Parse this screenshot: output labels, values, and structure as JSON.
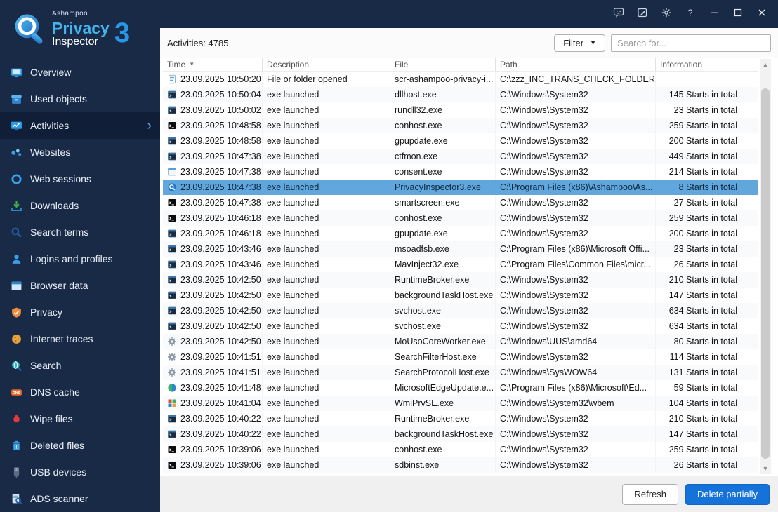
{
  "window": {
    "titlebar_icons": [
      {
        "name": "feedback"
      },
      {
        "name": "notes"
      },
      {
        "name": "settings"
      },
      {
        "name": "help"
      },
      {
        "name": "minimize"
      },
      {
        "name": "maximize"
      },
      {
        "name": "close"
      }
    ]
  },
  "logo": {
    "brand": "Ashampoo",
    "product": "Privacy",
    "product2": "Inspector",
    "version": "3"
  },
  "sidebar": {
    "items": [
      {
        "label": "Overview",
        "icon": "overview",
        "selected": false
      },
      {
        "label": "Used objects",
        "icon": "used-objects",
        "selected": false
      },
      {
        "label": "Activities",
        "icon": "activities",
        "selected": true
      },
      {
        "label": "Websites",
        "icon": "websites",
        "selected": false
      },
      {
        "label": "Web sessions",
        "icon": "web-sessions",
        "selected": false
      },
      {
        "label": "Downloads",
        "icon": "downloads",
        "selected": false
      },
      {
        "label": "Search terms",
        "icon": "search-terms",
        "selected": false
      },
      {
        "label": "Logins and profiles",
        "icon": "logins",
        "selected": false
      },
      {
        "label": "Browser data",
        "icon": "browser-data",
        "selected": false
      },
      {
        "label": "Privacy",
        "icon": "privacy",
        "selected": false
      },
      {
        "label": "Internet traces",
        "icon": "internet-traces",
        "selected": false
      },
      {
        "label": "Search",
        "icon": "search",
        "selected": false
      },
      {
        "label": "DNS cache",
        "icon": "dns-cache",
        "selected": false
      },
      {
        "label": "Wipe files",
        "icon": "wipe-files",
        "selected": false
      },
      {
        "label": "Deleted files",
        "icon": "deleted-files",
        "selected": false
      },
      {
        "label": "USB devices",
        "icon": "usb-devices",
        "selected": false
      },
      {
        "label": "ADS scanner",
        "icon": "ads-scanner",
        "selected": false
      }
    ]
  },
  "toolbar": {
    "activities_count": "Activities: 4785",
    "filter_label": "Filter",
    "search_placeholder": "Search for..."
  },
  "table": {
    "columns": [
      {
        "label": "Time",
        "sort": "desc"
      },
      {
        "label": "Description"
      },
      {
        "label": "File"
      },
      {
        "label": "Path"
      },
      {
        "label": "Information"
      }
    ],
    "rows": [
      {
        "time": "23.09.2025 10:50:20",
        "description": "File or folder opened",
        "file": "scr-ashampoo-privacy-i...",
        "path": "C:\\zzz_INC_TRANS_CHECK_FOLDER",
        "information": "",
        "icon": "doc",
        "selected": false
      },
      {
        "time": "23.09.2025 10:50:04",
        "description": "exe launched",
        "file": "dllhost.exe",
        "path": "C:\\Windows\\System32",
        "information": "145 Starts in total",
        "icon": "win",
        "selected": false
      },
      {
        "time": "23.09.2025 10:50:02",
        "description": "exe launched",
        "file": "rundll32.exe",
        "path": "C:\\Windows\\System32",
        "information": "23 Starts in total",
        "icon": "win",
        "selected": false
      },
      {
        "time": "23.09.2025 10:48:58",
        "description": "exe launched",
        "file": "conhost.exe",
        "path": "C:\\Windows\\System32",
        "information": "259 Starts in total",
        "icon": "console",
        "selected": false
      },
      {
        "time": "23.09.2025 10:48:58",
        "description": "exe launched",
        "file": "gpupdate.exe",
        "path": "C:\\Windows\\System32",
        "information": "200 Starts in total",
        "icon": "win",
        "selected": false
      },
      {
        "time": "23.09.2025 10:47:38",
        "description": "exe launched",
        "file": "ctfmon.exe",
        "path": "C:\\Windows\\System32",
        "information": "449 Starts in total",
        "icon": "win",
        "selected": false
      },
      {
        "time": "23.09.2025 10:47:38",
        "description": "exe launched",
        "file": "consent.exe",
        "path": "C:\\Windows\\System32",
        "information": "214 Starts in total",
        "icon": "winlight",
        "selected": false
      },
      {
        "time": "23.09.2025 10:47:38",
        "description": "exe launched",
        "file": "PrivacyInspector3.exe",
        "path": "C:\\Program Files (x86)\\Ashampoo\\As...",
        "information": "8 Starts in total",
        "icon": "app",
        "selected": true
      },
      {
        "time": "23.09.2025 10:47:38",
        "description": "exe launched",
        "file": "smartscreen.exe",
        "path": "C:\\Windows\\System32",
        "information": "27 Starts in total",
        "icon": "console",
        "selected": false
      },
      {
        "time": "23.09.2025 10:46:18",
        "description": "exe launched",
        "file": "conhost.exe",
        "path": "C:\\Windows\\System32",
        "information": "259 Starts in total",
        "icon": "console",
        "selected": false
      },
      {
        "time": "23.09.2025 10:46:18",
        "description": "exe launched",
        "file": "gpupdate.exe",
        "path": "C:\\Windows\\System32",
        "information": "200 Starts in total",
        "icon": "win",
        "selected": false
      },
      {
        "time": "23.09.2025 10:43:46",
        "description": "exe launched",
        "file": "msoadfsb.exe",
        "path": "C:\\Program Files (x86)\\Microsoft Offi...",
        "information": "23 Starts in total",
        "icon": "win",
        "selected": false
      },
      {
        "time": "23.09.2025 10:43:46",
        "description": "exe launched",
        "file": "MavInject32.exe",
        "path": "C:\\Program Files\\Common Files\\micr...",
        "information": "26 Starts in total",
        "icon": "win",
        "selected": false
      },
      {
        "time": "23.09.2025 10:42:50",
        "description": "exe launched",
        "file": "RuntimeBroker.exe",
        "path": "C:\\Windows\\System32",
        "information": "210 Starts in total",
        "icon": "win",
        "selected": false
      },
      {
        "time": "23.09.2025 10:42:50",
        "description": "exe launched",
        "file": "backgroundTaskHost.exe",
        "path": "C:\\Windows\\System32",
        "information": "147 Starts in total",
        "icon": "win",
        "selected": false
      },
      {
        "time": "23.09.2025 10:42:50",
        "description": "exe launched",
        "file": "svchost.exe",
        "path": "C:\\Windows\\System32",
        "information": "634 Starts in total",
        "icon": "win",
        "selected": false
      },
      {
        "time": "23.09.2025 10:42:50",
        "description": "exe launched",
        "file": "svchost.exe",
        "path": "C:\\Windows\\System32",
        "information": "634 Starts in total",
        "icon": "win",
        "selected": false
      },
      {
        "time": "23.09.2025 10:42:50",
        "description": "exe launched",
        "file": "MoUsoCoreWorker.exe",
        "path": "C:\\Windows\\UUS\\amd64",
        "information": "80 Starts in total",
        "icon": "gear",
        "selected": false
      },
      {
        "time": "23.09.2025 10:41:51",
        "description": "exe launched",
        "file": "SearchFilterHost.exe",
        "path": "C:\\Windows\\System32",
        "information": "114 Starts in total",
        "icon": "gear",
        "selected": false
      },
      {
        "time": "23.09.2025 10:41:51",
        "description": "exe launched",
        "file": "SearchProtocolHost.exe",
        "path": "C:\\Windows\\SysWOW64",
        "information": "131 Starts in total",
        "icon": "gear",
        "selected": false
      },
      {
        "time": "23.09.2025 10:41:48",
        "description": "exe launched",
        "file": "MicrosoftEdgeUpdate.e...",
        "path": "C:\\Program Files (x86)\\Microsoft\\Ed...",
        "information": "59 Starts in total",
        "icon": "edge",
        "selected": false
      },
      {
        "time": "23.09.2025 10:41:04",
        "description": "exe launched",
        "file": "WmiPrvSE.exe",
        "path": "C:\\Windows\\System32\\wbem",
        "information": "104 Starts in total",
        "icon": "wmi",
        "selected": false
      },
      {
        "time": "23.09.2025 10:40:22",
        "description": "exe launched",
        "file": "RuntimeBroker.exe",
        "path": "C:\\Windows\\System32",
        "information": "210 Starts in total",
        "icon": "win",
        "selected": false
      },
      {
        "time": "23.09.2025 10:40:22",
        "description": "exe launched",
        "file": "backgroundTaskHost.exe",
        "path": "C:\\Windows\\System32",
        "information": "147 Starts in total",
        "icon": "win",
        "selected": false
      },
      {
        "time": "23.09.2025 10:39:06",
        "description": "exe launched",
        "file": "conhost.exe",
        "path": "C:\\Windows\\System32",
        "information": "259 Starts in total",
        "icon": "console",
        "selected": false
      },
      {
        "time": "23.09.2025 10:39:06",
        "description": "exe launched",
        "file": "sdbinst.exe",
        "path": "C:\\Windows\\System32",
        "information": "26 Starts in total",
        "icon": "console",
        "selected": false
      }
    ]
  },
  "footer": {
    "refresh_label": "Refresh",
    "delete_label": "Delete partially"
  },
  "colors": {
    "sidebar_bg": "#192A47",
    "sidebar_selected_bg": "#101E38",
    "accent_blue": "#2798E8",
    "selected_row_bg": "#61A7DC",
    "primary_button": "#1572D8"
  }
}
